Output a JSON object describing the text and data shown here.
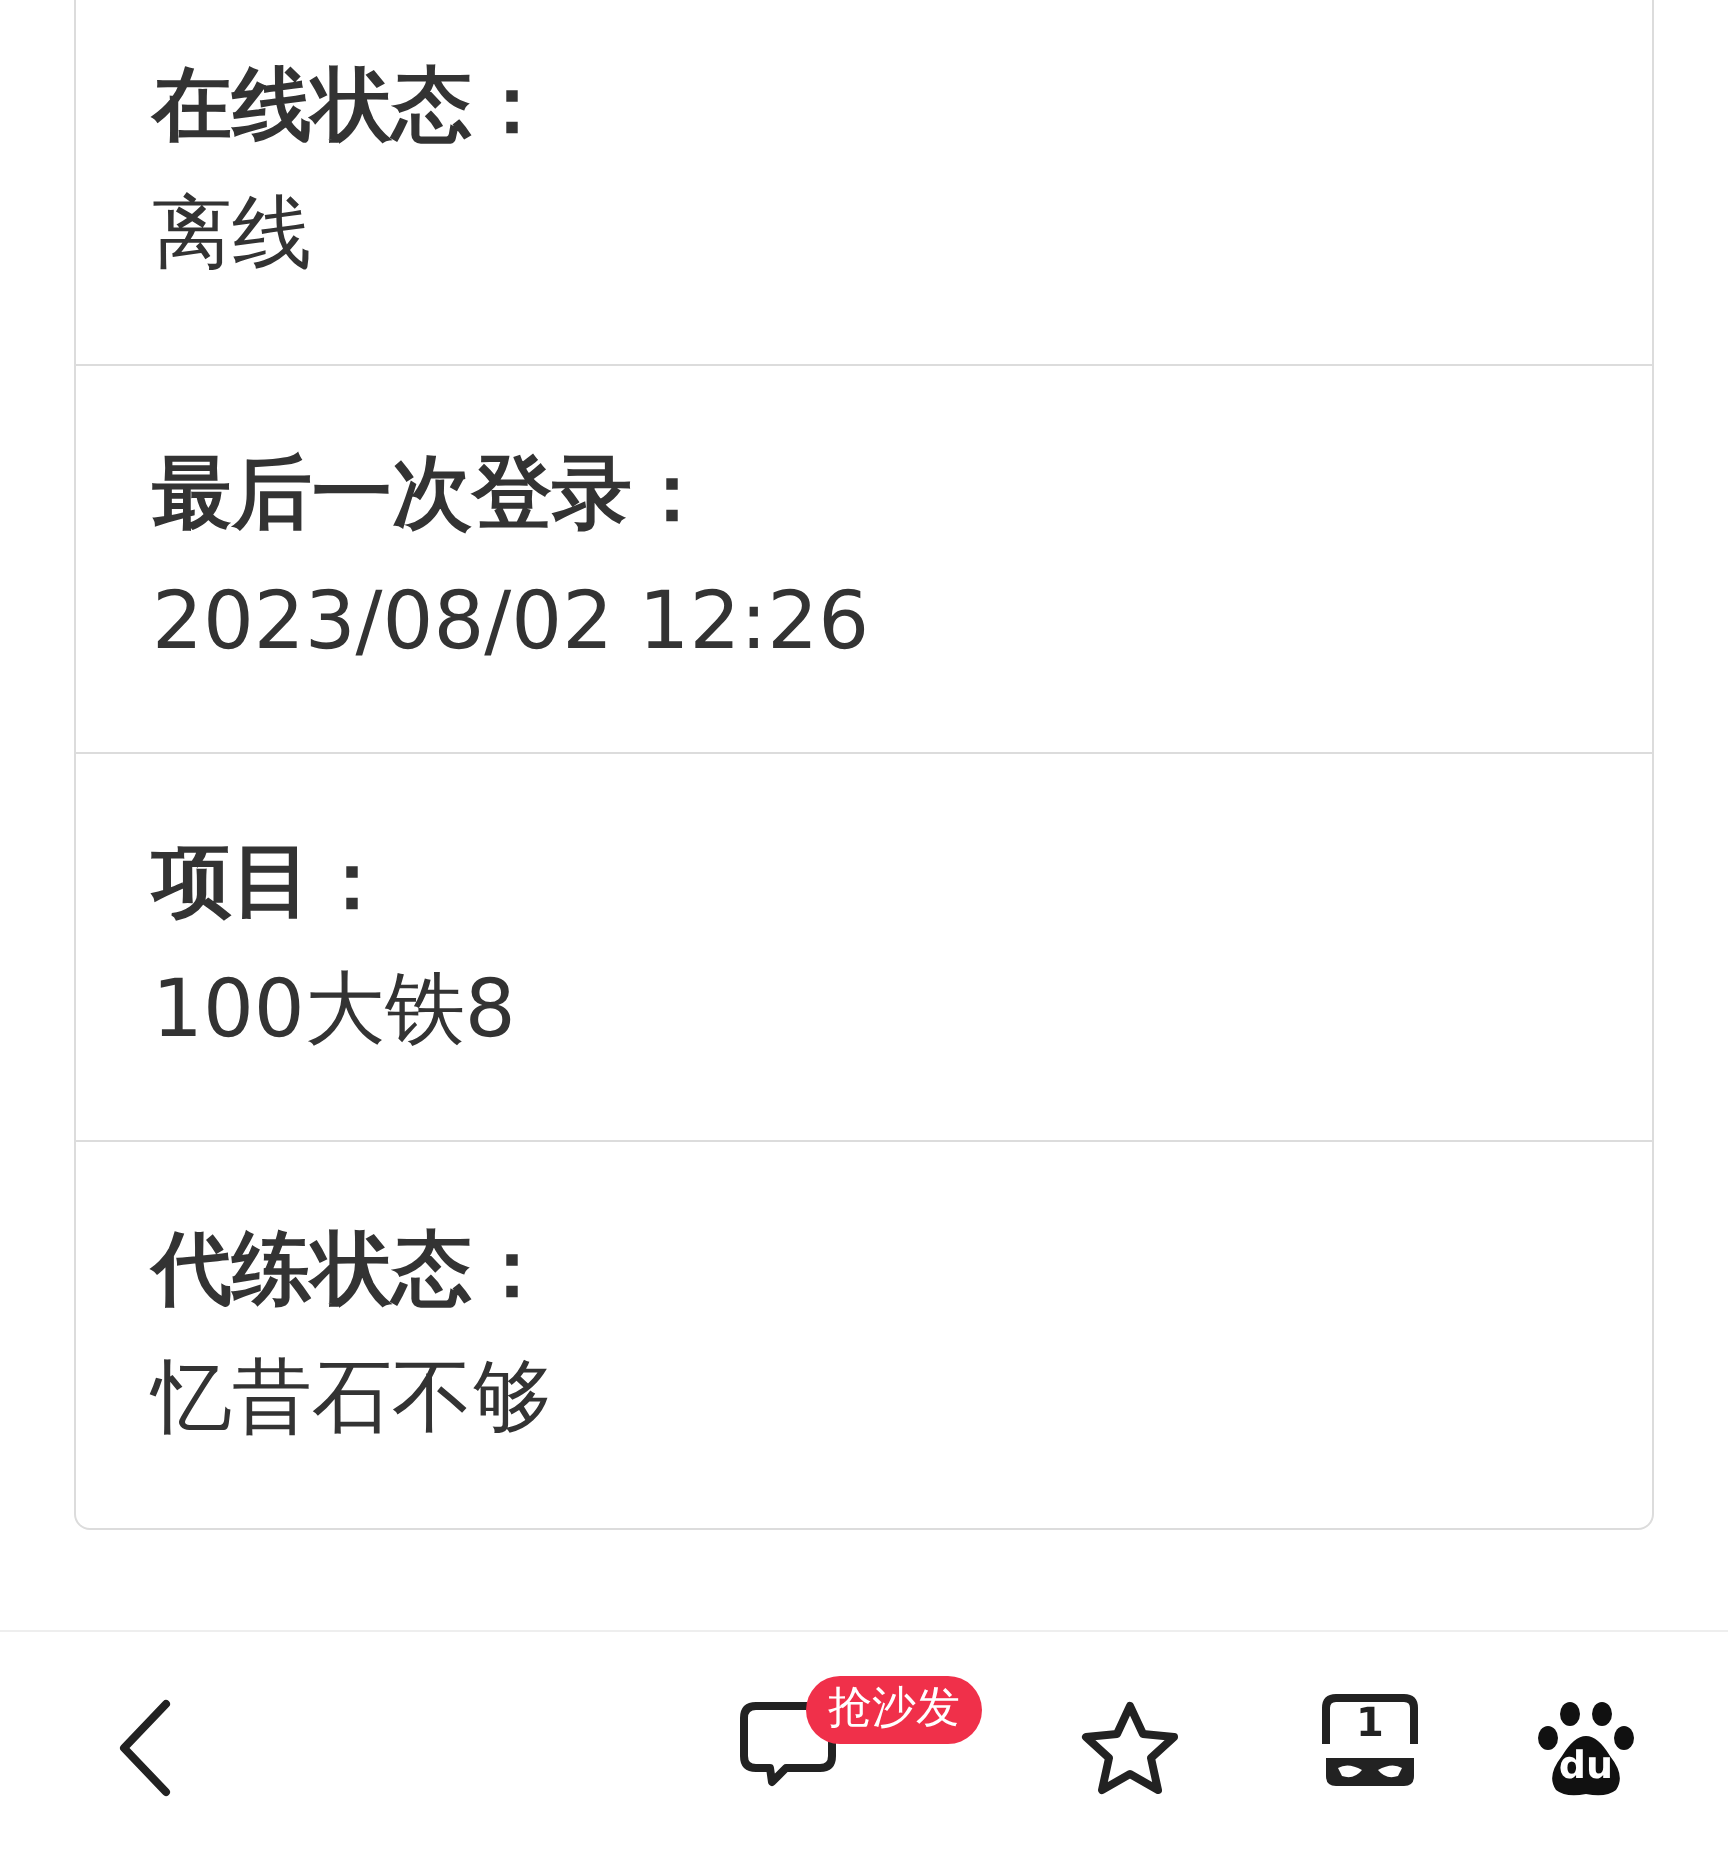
{
  "fields": [
    {
      "label": "在线状态：",
      "value": "离线"
    },
    {
      "label": "最后一次登录：",
      "value": "2023/08/02 12:26"
    },
    {
      "label": "项目：",
      "value": "100大铁8"
    },
    {
      "label": "代练状态：",
      "value": "忆昔石不够"
    }
  ],
  "toolbar": {
    "comment_badge": "抢沙发",
    "tab_count": "1",
    "logo_text": "du"
  }
}
